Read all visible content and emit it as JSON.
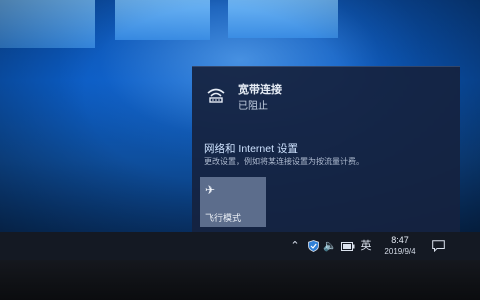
{
  "network": {
    "name": "宽带连接",
    "status": "已阻止",
    "icon": "dialup-network-icon"
  },
  "settings": {
    "link_label": "网络和 Internet 设置",
    "description": "更改设置，例如将某连接设置为按流量计费。"
  },
  "quick_actions": {
    "airplane_label": "飞行模式",
    "airplane_icon": "airplane-icon"
  },
  "taskbar": {
    "ime": "英",
    "time": "8:47",
    "date": "2019/9/4",
    "icons": [
      "chevron-up-icon",
      "shield-icon",
      "volume-icon",
      "battery-icon",
      "notification-icon"
    ]
  },
  "colors": {
    "flyout_bg": "#162240",
    "tile_bg": "#5c6d8c",
    "taskbar_bg": "#141923",
    "link": "#cfe3ff"
  }
}
